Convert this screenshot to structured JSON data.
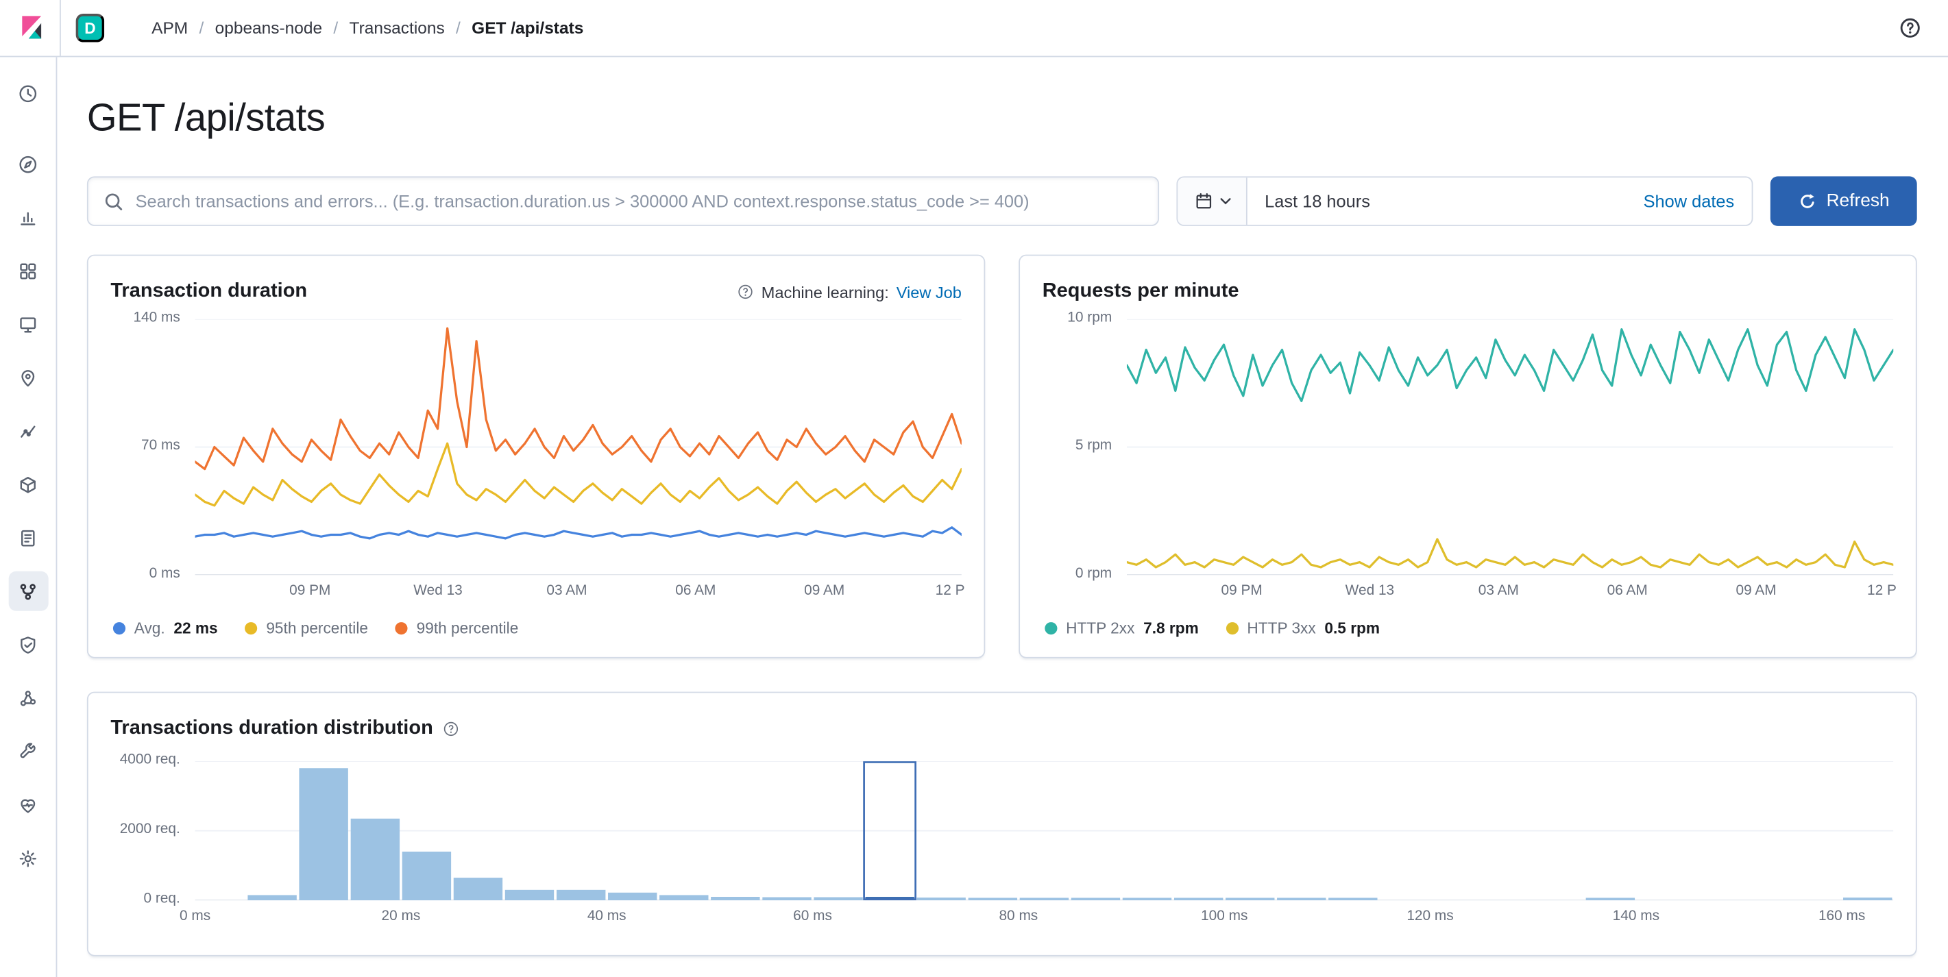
{
  "topbar": {
    "space_badge": "D",
    "breadcrumbs": [
      "APM",
      "opbeans-node",
      "Transactions",
      "GET /api/stats"
    ]
  },
  "page": {
    "title": "GET /api/stats"
  },
  "toolbar": {
    "search_placeholder": "Search transactions and errors... (E.g. transaction.duration.us > 300000 AND context.response.status_code >= 400)",
    "time_range": "Last 18 hours",
    "show_dates_label": "Show dates",
    "refresh_label": "Refresh"
  },
  "sidebar": {
    "items": [
      "recently-viewed",
      "discover",
      "visualize",
      "dashboard",
      "canvas",
      "maps",
      "machine-learning",
      "infrastructure",
      "logs",
      "apm",
      "uptime",
      "graph",
      "dev-tools",
      "monitoring",
      "management"
    ],
    "selected": "apm"
  },
  "panels": {
    "duration": {
      "title": "Transaction duration",
      "ml_prefix": "Machine learning:",
      "ml_link": "View Job"
    },
    "rpm": {
      "title": "Requests per minute"
    },
    "distribution": {
      "title": "Transactions duration distribution"
    }
  },
  "colors": {
    "link": "#006BB4",
    "refresh_button": "#2A62B0",
    "grid": "#edf0f6",
    "baseline": "#d8dde6"
  },
  "chart_data": [
    {
      "id": "transaction-duration",
      "type": "line",
      "title": "Transaction duration",
      "ymax": 140,
      "yticks": [
        {
          "v": 0,
          "label": "0 ms"
        },
        {
          "v": 70,
          "label": "70 ms"
        },
        {
          "v": 140,
          "label": "140 ms"
        }
      ],
      "xticks": [
        {
          "f": 0.15,
          "label": "09 PM"
        },
        {
          "f": 0.317,
          "label": "Wed 13"
        },
        {
          "f": 0.485,
          "label": "03 AM"
        },
        {
          "f": 0.653,
          "label": "06 AM"
        },
        {
          "f": 0.821,
          "label": "09 AM"
        },
        {
          "f": 0.985,
          "label": "12 P"
        }
      ],
      "series": [
        {
          "name": "Avg.",
          "value_label": "22 ms",
          "color": "#4583DE",
          "values": [
            21,
            22,
            22,
            23,
            21,
            22,
            23,
            22,
            21,
            22,
            23,
            24,
            22,
            21,
            22,
            22,
            23,
            21,
            20,
            22,
            23,
            22,
            24,
            22,
            21,
            23,
            22,
            21,
            22,
            23,
            22,
            21,
            20,
            22,
            23,
            22,
            21,
            22,
            24,
            23,
            22,
            21,
            22,
            23,
            21,
            22,
            22,
            23,
            22,
            21,
            22,
            23,
            24,
            22,
            21,
            22,
            23,
            22,
            21,
            22,
            21,
            22,
            23,
            22,
            24,
            23,
            22,
            21,
            22,
            23,
            22,
            21,
            22,
            23,
            22,
            21,
            24,
            23,
            26,
            22
          ]
        },
        {
          "name": "95th percentile",
          "value_label": "",
          "color": "#E8BA27",
          "values": [
            44,
            40,
            38,
            46,
            42,
            39,
            48,
            44,
            41,
            52,
            47,
            43,
            40,
            46,
            50,
            44,
            41,
            39,
            47,
            55,
            49,
            44,
            40,
            46,
            43,
            58,
            72,
            50,
            44,
            41,
            47,
            44,
            40,
            46,
            52,
            46,
            42,
            48,
            44,
            40,
            46,
            50,
            45,
            41,
            47,
            43,
            39,
            45,
            50,
            44,
            40,
            46,
            42,
            48,
            53,
            46,
            41,
            44,
            48,
            43,
            39,
            46,
            51,
            45,
            40,
            44,
            47,
            42,
            46,
            50,
            44,
            40,
            45,
            49,
            43,
            40,
            46,
            52,
            47,
            58
          ]
        },
        {
          "name": "99th percentile",
          "value_label": "",
          "color": "#EF7330",
          "values": [
            62,
            58,
            70,
            65,
            60,
            75,
            68,
            62,
            80,
            72,
            66,
            62,
            74,
            68,
            63,
            85,
            76,
            68,
            64,
            72,
            66,
            78,
            70,
            64,
            90,
            80,
            135,
            95,
            70,
            128,
            85,
            68,
            74,
            66,
            72,
            80,
            70,
            64,
            76,
            68,
            74,
            82,
            72,
            66,
            70,
            76,
            68,
            62,
            74,
            80,
            70,
            65,
            72,
            66,
            76,
            70,
            64,
            72,
            78,
            68,
            63,
            74,
            70,
            80,
            72,
            66,
            70,
            76,
            68,
            62,
            74,
            70,
            66,
            78,
            84,
            70,
            64,
            76,
            88,
            72
          ]
        }
      ]
    },
    {
      "id": "requests-per-minute",
      "type": "line",
      "title": "Requests per minute",
      "ymax": 10,
      "yticks": [
        {
          "v": 0,
          "label": "0 rpm"
        },
        {
          "v": 5,
          "label": "5 rpm"
        },
        {
          "v": 10,
          "label": "10 rpm"
        }
      ],
      "xticks": [
        {
          "f": 0.15,
          "label": "09 PM"
        },
        {
          "f": 0.317,
          "label": "Wed 13"
        },
        {
          "f": 0.485,
          "label": "03 AM"
        },
        {
          "f": 0.653,
          "label": "06 AM"
        },
        {
          "f": 0.821,
          "label": "09 AM"
        },
        {
          "f": 0.985,
          "label": "12 P"
        }
      ],
      "series": [
        {
          "name": "HTTP 2xx",
          "value_label": "7.8 rpm",
          "color": "#2FB3A6",
          "values": [
            8.2,
            7.5,
            8.8,
            7.9,
            8.5,
            7.2,
            8.9,
            8.1,
            7.6,
            8.4,
            9.0,
            7.8,
            7.0,
            8.6,
            7.4,
            8.2,
            8.8,
            7.5,
            6.8,
            8.0,
            8.6,
            7.9,
            8.3,
            7.1,
            8.7,
            8.2,
            7.6,
            8.9,
            8.0,
            7.4,
            8.5,
            7.8,
            8.2,
            8.8,
            7.3,
            8.0,
            8.5,
            7.7,
            9.2,
            8.4,
            7.8,
            8.6,
            8.0,
            7.2,
            8.8,
            8.2,
            7.6,
            8.4,
            9.4,
            8.0,
            7.4,
            9.6,
            8.6,
            7.8,
            9.0,
            8.2,
            7.5,
            9.5,
            8.8,
            7.9,
            9.2,
            8.4,
            7.6,
            8.8,
            9.6,
            8.2,
            7.4,
            9.0,
            9.5,
            8.0,
            7.2,
            8.6,
            9.3,
            8.5,
            7.7,
            9.6,
            8.8,
            7.6,
            8.2,
            8.8
          ]
        },
        {
          "name": "HTTP 3xx",
          "value_label": "0.5 rpm",
          "color": "#DFBE2C",
          "values": [
            0.5,
            0.4,
            0.6,
            0.3,
            0.5,
            0.8,
            0.4,
            0.5,
            0.3,
            0.6,
            0.5,
            0.4,
            0.7,
            0.5,
            0.3,
            0.6,
            0.4,
            0.5,
            0.8,
            0.4,
            0.3,
            0.5,
            0.6,
            0.4,
            0.5,
            0.3,
            0.7,
            0.5,
            0.4,
            0.6,
            0.3,
            0.5,
            1.4,
            0.6,
            0.4,
            0.5,
            0.3,
            0.6,
            0.5,
            0.4,
            0.7,
            0.4,
            0.5,
            0.3,
            0.6,
            0.5,
            0.4,
            0.8,
            0.5,
            0.3,
            0.6,
            0.4,
            0.5,
            0.7,
            0.4,
            0.3,
            0.6,
            0.5,
            0.4,
            0.8,
            0.5,
            0.4,
            0.6,
            0.3,
            0.5,
            0.7,
            0.4,
            0.5,
            0.3,
            0.6,
            0.4,
            0.5,
            0.8,
            0.4,
            0.3,
            1.3,
            0.6,
            0.4,
            0.5,
            0.4
          ]
        }
      ]
    },
    {
      "id": "transactions-duration-distribution",
      "type": "bar",
      "title": "Transactions duration distribution",
      "bucket_size_ms": 5,
      "x_max_ms": 165,
      "ymax": 4000,
      "yticks": [
        {
          "v": 0,
          "label": "0 req."
        },
        {
          "v": 2000,
          "label": "2000 req."
        },
        {
          "v": 4000,
          "label": "4000 req."
        }
      ],
      "xticks": [
        {
          "v": 0,
          "label": "0 ms"
        },
        {
          "v": 20,
          "label": "20 ms"
        },
        {
          "v": 40,
          "label": "40 ms"
        },
        {
          "v": 60,
          "label": "60 ms"
        },
        {
          "v": 80,
          "label": "80 ms"
        },
        {
          "v": 100,
          "label": "100 ms"
        },
        {
          "v": 120,
          "label": "120 ms"
        },
        {
          "v": 140,
          "label": "140 ms"
        },
        {
          "v": 160,
          "label": "160 ms"
        }
      ],
      "values": [
        0,
        150,
        3800,
        2350,
        1400,
        650,
        300,
        300,
        220,
        150,
        100,
        90,
        90,
        100,
        80,
        70,
        70,
        60,
        60,
        60,
        60,
        60,
        60,
        0,
        0,
        0,
        0,
        70,
        0,
        0,
        0,
        0,
        80
      ],
      "selected_bucket_index": 13,
      "bar_color": "#9CC2E3",
      "selected_bar_color": "#3D6FB2",
      "selection_outline_color": "#3F6EB5"
    }
  ]
}
